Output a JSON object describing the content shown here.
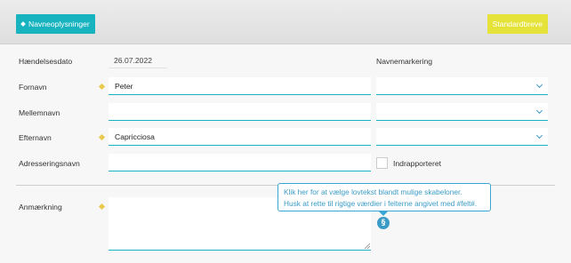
{
  "toolbar": {
    "name_info_label": "Navneoplysninger",
    "standard_letters_label": "Standardbreve"
  },
  "form": {
    "event_date": {
      "label": "Hændelsesdato",
      "value": "26.07.2022"
    },
    "first_name": {
      "label": "Fornavn",
      "value": "Peter",
      "required": true
    },
    "middle_name": {
      "label": "Mellemnavn",
      "value": ""
    },
    "last_name": {
      "label": "Efternavn",
      "value": "Capricciosa",
      "required": true
    },
    "address_name": {
      "label": "Adresseringsnavn",
      "value": ""
    },
    "name_marking": {
      "label": "Navnemarkering"
    },
    "reported": {
      "label": "Indrapporteret",
      "checked": false
    },
    "remark": {
      "label": "Anmærkning",
      "value": "",
      "required": true
    }
  },
  "tooltip": {
    "line1": "Klik her for at vælge lovtekst blandt mulige skabeloner.",
    "line2": "Husk at rette til rigtige værdier i felterne angivet med #felt#."
  },
  "icons": {
    "paragraph": "§",
    "accent_color": "#17b3bf",
    "link_color": "#3a9bc6",
    "yellow_button": "#e5e23a",
    "required_marker": "#e8c94a"
  }
}
